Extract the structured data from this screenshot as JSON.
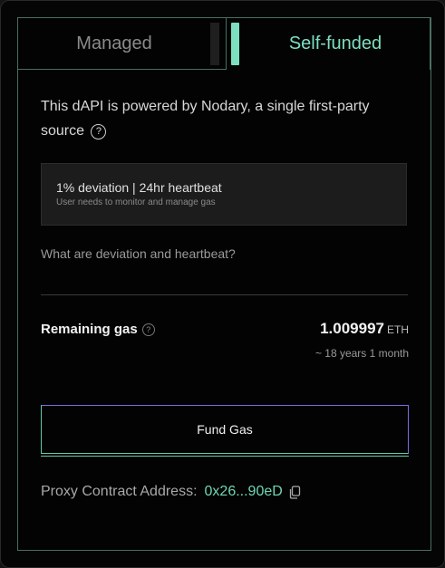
{
  "tabs": {
    "managed_label": "Managed",
    "self_funded_label": "Self-funded"
  },
  "intro": {
    "text": "This dAPI is powered by Nodary, a single first-party source",
    "help_glyph": "?"
  },
  "info_box": {
    "title": "1% deviation | 24hr heartbeat",
    "subtitle": "User needs to monitor and manage gas"
  },
  "help_link": "What are deviation and heartbeat?",
  "gas": {
    "label": "Remaining gas",
    "help_glyph": "?",
    "value": "1.009997",
    "unit": "ETH",
    "duration": "~ 18 years 1 month"
  },
  "fund_button_label": "Fund Gas",
  "proxy": {
    "label": "Proxy Contract Address:",
    "address": "0x26...90eD",
    "copy_icon": "copy-icon"
  },
  "colors": {
    "accent": "#7ddfc0",
    "border": "#4a6e62",
    "button_border": "#7d6ee0"
  }
}
